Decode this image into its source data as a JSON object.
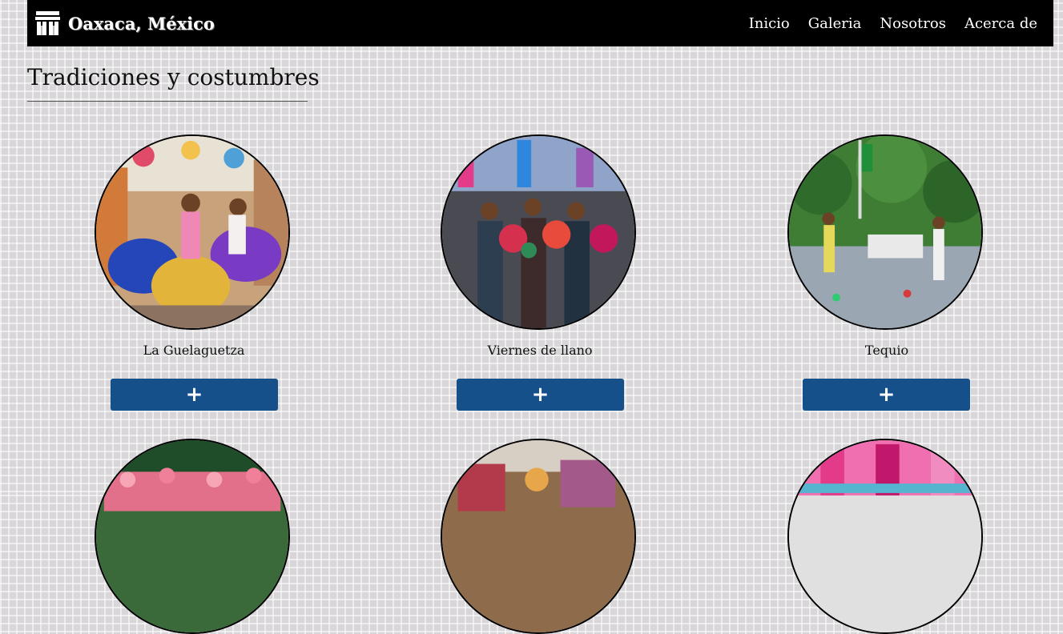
{
  "header": {
    "brand": "Oaxaca, México",
    "brand_icon": "monument-icon",
    "nav": [
      "Inicio",
      "Galeria",
      "Nosotros",
      "Acerca de"
    ]
  },
  "main": {
    "title": "Tradiciones y costumbres",
    "cards": [
      {
        "label": "La Guelaguetza",
        "button": "+",
        "image": "dancers-photo"
      },
      {
        "label": "Viernes de llano",
        "button": "+",
        "image": "flower-parade-photo"
      },
      {
        "label": "Tequio",
        "button": "+",
        "image": "community-work-photo"
      }
    ],
    "cards_row2_images": [
      "flower-boat-photo",
      "market-photo",
      "papel-picado-photo"
    ]
  },
  "colors": {
    "navbar": "#000000",
    "button": "#15508a",
    "background": "#d9d6da"
  }
}
